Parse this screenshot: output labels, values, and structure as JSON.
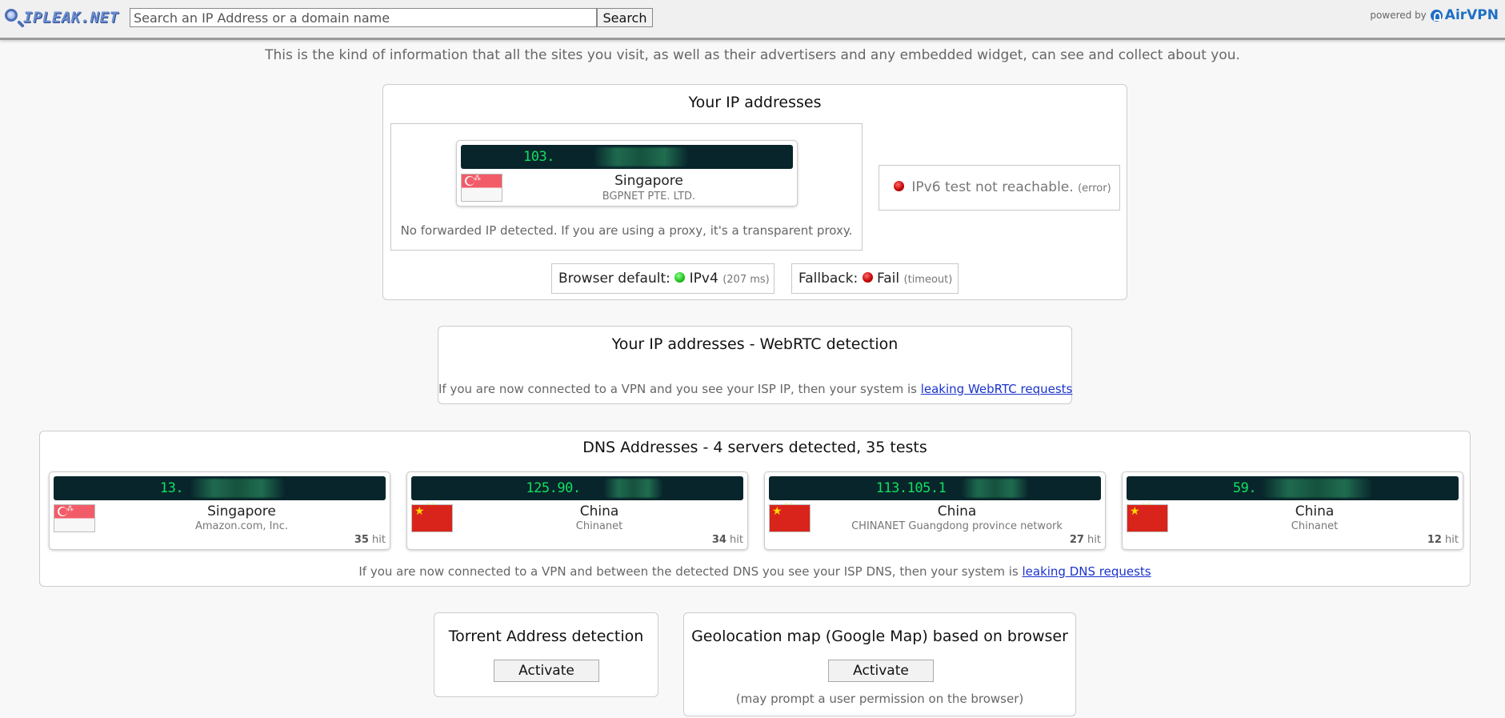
{
  "header": {
    "logo_text": "IPLEAK.NET",
    "search_placeholder": "Search an IP Address or a domain name",
    "search_button": "Search",
    "powered_by": "powered by",
    "brand": "AirVPN"
  },
  "intro": "This is the kind of information that all the sites you visit, as well as their advertisers and any embedded widget, can see and collect about you.",
  "ip_section": {
    "title": "Your IP addresses",
    "ipv4": {
      "ip": "103.",
      "country": "Singapore",
      "isp": "BGPNET PTE. LTD.",
      "flag": "flag-singapore"
    },
    "forwarded_note": "No forwarded IP detected. If you are using a proxy, it's a transparent proxy.",
    "ipv6": {
      "text": "IPv6 test not reachable.",
      "status": "(error)"
    },
    "browser_default": {
      "label": "Browser default:",
      "value": "IPv4",
      "detail": "(207 ms)"
    },
    "fallback": {
      "label": "Fallback:",
      "value": "Fail",
      "detail": "(timeout)"
    }
  },
  "webrtc": {
    "title": "Your IP addresses - WebRTC detection",
    "note_prefix": "If you are now connected to a VPN and you see your ISP IP, then your system is",
    "note_link": "leaking WebRTC requests"
  },
  "dns": {
    "title": "DNS Addresses - 4 servers detected, 35 tests",
    "servers": [
      {
        "ip": "13.",
        "country": "Singapore",
        "isp": "Amazon.com, Inc.",
        "hits": "35",
        "hit_label": "hit",
        "flag": "flag-singapore"
      },
      {
        "ip": "125.90.",
        "country": "China",
        "isp": "Chinanet",
        "hits": "34",
        "hit_label": "hit",
        "flag": "flag-china"
      },
      {
        "ip": "113.105.1",
        "country": "China",
        "isp": "CHINANET Guangdong province network",
        "hits": "27",
        "hit_label": "hit",
        "flag": "flag-china"
      },
      {
        "ip": "59.",
        "country": "China",
        "isp": "Chinanet",
        "hits": "12",
        "hit_label": "hit",
        "flag": "flag-china"
      }
    ],
    "note_prefix": "If you are now connected to a VPN and between the detected DNS you see your ISP DNS, then your system is",
    "note_link": "leaking DNS requests"
  },
  "torrent": {
    "title": "Torrent Address detection",
    "button": "Activate"
  },
  "geo": {
    "title": "Geolocation map (Google Map) based on browser",
    "button": "Activate",
    "note": "(may prompt a user permission on the browser)"
  },
  "colors": {
    "ip_bar_bg": "#08252b",
    "ip_text": "#10e060",
    "link": "#1a33cc",
    "brand": "#1f6fc4"
  }
}
